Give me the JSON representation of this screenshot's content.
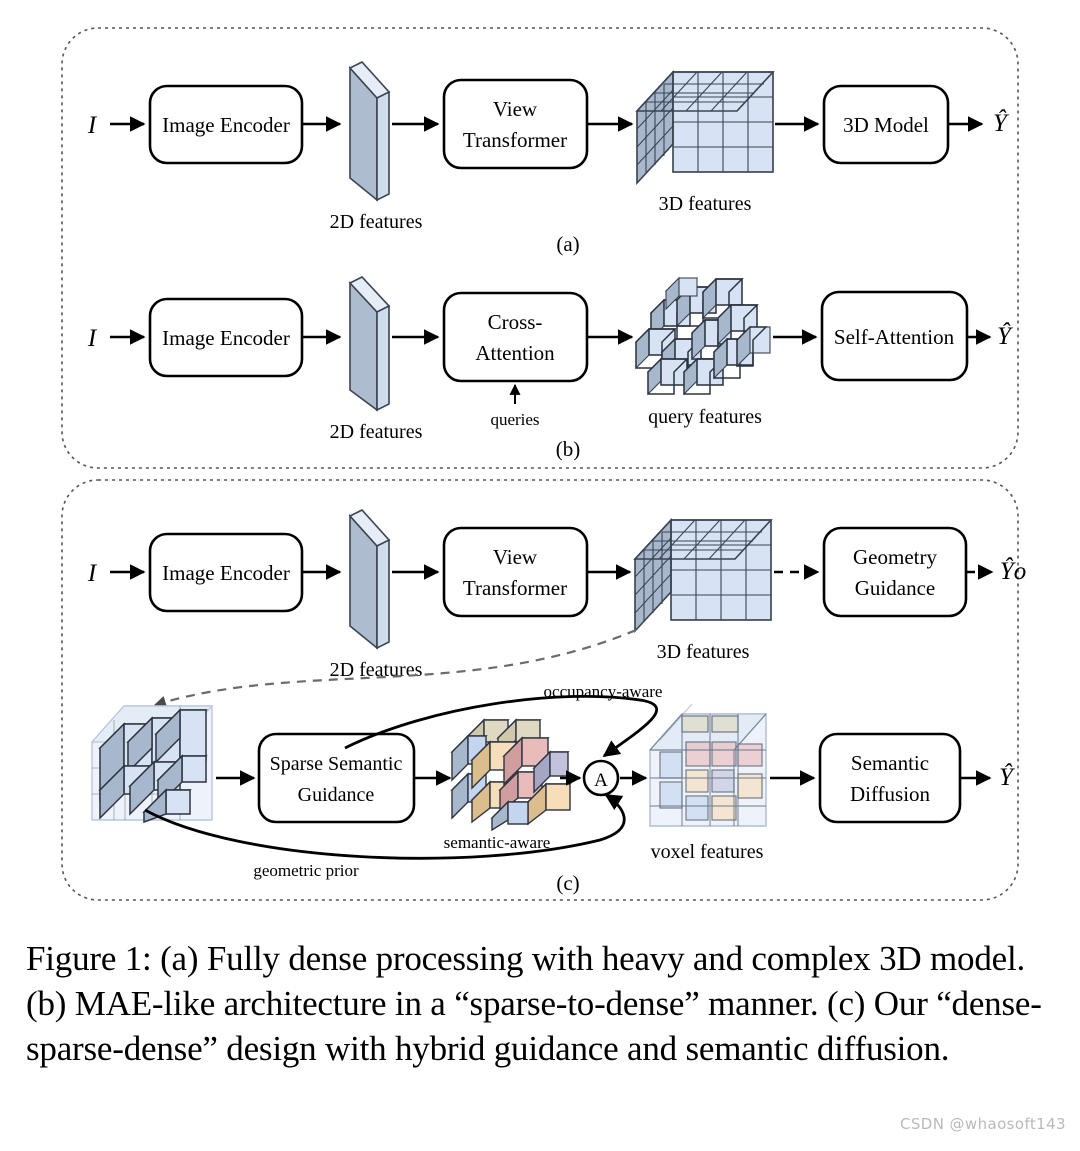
{
  "figure": {
    "caption": "Figure 1: (a) Fully dense processing with heavy and complex 3D model. (b) MAE-like architecture in a “sparse-to-dense” manner. (c) Our “dense-sparse-dense” design with hybrid guidance and semantic diffusion.",
    "watermark": "CSDN @whaosoft143"
  },
  "colors": {
    "voxel_front": "#d7e3f4",
    "voxel_side": "#a8b8cc",
    "voxel_top": "#c2cfe0",
    "plane_front": "#adbccf",
    "plane_edge": "#cfdcee",
    "outline": "#3b4452",
    "stroke": "#000000",
    "panel_border": "#555555",
    "sem_tan": "#ded9c0",
    "sem_peach": "#f7ddba",
    "sem_pink": "#e9bcbc",
    "sem_lavender": "#c2c2dc",
    "sem_blue": "#c4d6ef",
    "watermark_gray": "#b9b9b9"
  },
  "panels": [
    {
      "id": "a",
      "label": "(a)"
    },
    {
      "id": "b",
      "label": "(b)"
    },
    {
      "id": "c",
      "label": "(c)"
    }
  ],
  "row_a": {
    "input": "I",
    "output": "Ŷ",
    "blocks": [
      {
        "name": "image-encoder",
        "lines": [
          "Image Encoder"
        ]
      },
      {
        "name": "view-transformer",
        "lines": [
          "View",
          "Transformer"
        ]
      },
      {
        "name": "3d-model",
        "lines": [
          "3D Model"
        ]
      }
    ],
    "artifacts": [
      {
        "name": "2d-features",
        "label": "2D features"
      },
      {
        "name": "3d-features",
        "label": "3D features"
      }
    ]
  },
  "row_b": {
    "input": "I",
    "output": "Ŷ",
    "queries_label": "queries",
    "blocks": [
      {
        "name": "image-encoder",
        "lines": [
          "Image Encoder"
        ]
      },
      {
        "name": "cross-attention",
        "lines": [
          "Cross-",
          "Attention"
        ]
      },
      {
        "name": "self-attention",
        "lines": [
          "Self-Attention"
        ]
      }
    ],
    "artifacts": [
      {
        "name": "2d-features",
        "label": "2D features"
      },
      {
        "name": "query-features",
        "label": "query features"
      }
    ]
  },
  "row_c": {
    "input": "I",
    "output_geometry": "Ŷo",
    "output_final": "Ŷ",
    "merge_symbol": "A",
    "blocks": [
      {
        "name": "image-encoder",
        "lines": [
          "Image Encoder"
        ]
      },
      {
        "name": "view-transformer",
        "lines": [
          "View",
          "Transformer"
        ]
      },
      {
        "name": "geometry-guidance",
        "lines": [
          "Geometry",
          "Guidance"
        ]
      },
      {
        "name": "sparse-semantic-guidance",
        "lines": [
          "Sparse Semantic",
          "Guidance"
        ]
      },
      {
        "name": "semantic-diffusion",
        "lines": [
          "Semantic",
          "Diffusion"
        ]
      }
    ],
    "artifacts": [
      {
        "name": "2d-features",
        "label": "2D features"
      },
      {
        "name": "3d-features",
        "label": "3D features"
      },
      {
        "name": "semantic-aware",
        "label": "semantic-aware"
      },
      {
        "name": "voxel-features",
        "label": "voxel features"
      }
    ],
    "edge_labels": [
      {
        "name": "occupancy-aware",
        "label": "occupancy-aware"
      },
      {
        "name": "geometric-prior",
        "label": "geometric prior"
      }
    ]
  }
}
